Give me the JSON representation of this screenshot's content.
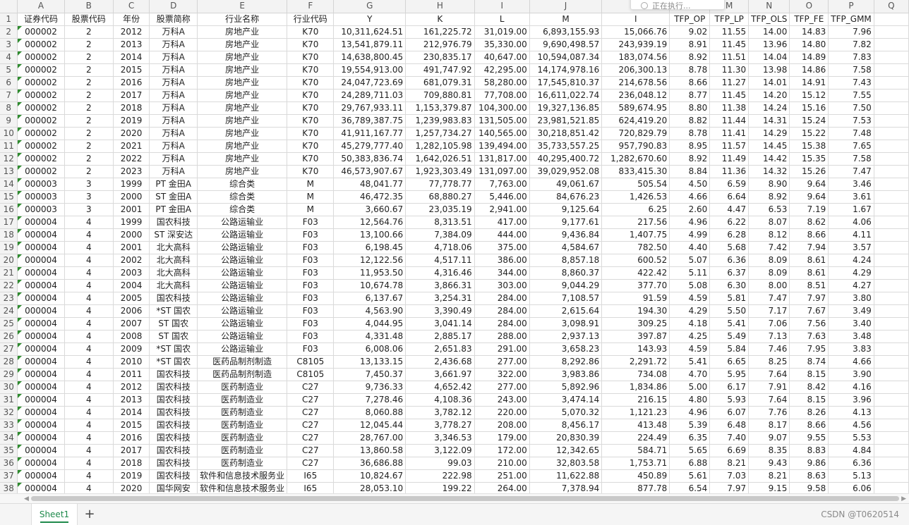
{
  "app": {
    "popup_text": "正在执行...",
    "sheet_tab": "Sheet1",
    "add_sheet_symbol": "+",
    "watermark": "CSDN @T0620514",
    "accent_color": "#1f8a4c"
  },
  "column_letters": [
    "A",
    "B",
    "C",
    "D",
    "E",
    "F",
    "G",
    "H",
    "I",
    "J",
    "K",
    "L",
    "M",
    "N",
    "O",
    "P",
    "Q"
  ],
  "headers": [
    "证券代码",
    "股票代码",
    "年份",
    "股票简称",
    "行业名称",
    "行业代码",
    "Y",
    "K",
    "L",
    "M",
    "I",
    "TFP_OP",
    "TFP_LP",
    "TFP_OLS",
    "TFP_FE",
    "TFP_GMM",
    ""
  ],
  "rows": [
    [
      "000002",
      "2",
      "2012",
      "万科A",
      "房地产业",
      "K70",
      "10,311,624.51",
      "161,225.72",
      "31,019.00",
      "6,893,155.93",
      "15,066.76",
      "9.02",
      "11.55",
      "14.00",
      "14.83",
      "7.96",
      ""
    ],
    [
      "000002",
      "2",
      "2013",
      "万科A",
      "房地产业",
      "K70",
      "13,541,879.11",
      "212,976.79",
      "35,330.00",
      "9,690,498.57",
      "243,939.19",
      "8.91",
      "11.45",
      "13.96",
      "14.80",
      "7.82",
      ""
    ],
    [
      "000002",
      "2",
      "2014",
      "万科A",
      "房地产业",
      "K70",
      "14,638,800.45",
      "230,835.17",
      "40,647.00",
      "10,594,087.34",
      "183,074.56",
      "8.92",
      "11.51",
      "14.04",
      "14.89",
      "7.83",
      ""
    ],
    [
      "000002",
      "2",
      "2015",
      "万科A",
      "房地产业",
      "K70",
      "19,554,913.00",
      "491,747.92",
      "42,295.00",
      "14,174,978.16",
      "206,300.13",
      "8.78",
      "11.30",
      "13.98",
      "14.86",
      "7.58",
      ""
    ],
    [
      "000002",
      "2",
      "2016",
      "万科A",
      "房地产业",
      "K70",
      "24,047,723.69",
      "681,079.31",
      "58,280.00",
      "17,545,810.37",
      "214,678.56",
      "8.66",
      "11.27",
      "14.01",
      "14.91",
      "7.43",
      ""
    ],
    [
      "000002",
      "2",
      "2017",
      "万科A",
      "房地产业",
      "K70",
      "24,289,711.03",
      "709,880.81",
      "77,708.00",
      "16,611,022.74",
      "236,048.12",
      "8.77",
      "11.45",
      "14.20",
      "15.12",
      "7.55",
      ""
    ],
    [
      "000002",
      "2",
      "2018",
      "万科A",
      "房地产业",
      "K70",
      "29,767,933.11",
      "1,153,379.87",
      "104,300.00",
      "19,327,136.85",
      "589,674.95",
      "8.80",
      "11.38",
      "14.24",
      "15.16",
      "7.50",
      ""
    ],
    [
      "000002",
      "2",
      "2019",
      "万科A",
      "房地产业",
      "K70",
      "36,789,387.75",
      "1,239,983.83",
      "131,505.00",
      "23,981,521.85",
      "624,419.20",
      "8.82",
      "11.44",
      "14.31",
      "15.24",
      "7.53",
      ""
    ],
    [
      "000002",
      "2",
      "2020",
      "万科A",
      "房地产业",
      "K70",
      "41,911,167.77",
      "1,257,734.27",
      "140,565.00",
      "30,218,851.42",
      "720,829.79",
      "8.78",
      "11.41",
      "14.29",
      "15.22",
      "7.48",
      ""
    ],
    [
      "000002",
      "2",
      "2021",
      "万科A",
      "房地产业",
      "K70",
      "45,279,777.40",
      "1,282,105.98",
      "139,494.00",
      "35,733,557.25",
      "957,790.83",
      "8.95",
      "11.57",
      "14.45",
      "15.38",
      "7.65",
      ""
    ],
    [
      "000002",
      "2",
      "2022",
      "万科A",
      "房地产业",
      "K70",
      "50,383,836.74",
      "1,642,026.51",
      "131,817.00",
      "40,295,400.72",
      "1,282,670.60",
      "8.92",
      "11.49",
      "14.42",
      "15.35",
      "7.58",
      ""
    ],
    [
      "000002",
      "2",
      "2023",
      "万科A",
      "房地产业",
      "K70",
      "46,573,907.67",
      "1,923,303.49",
      "131,097.00",
      "39,029,952.08",
      "833,415.30",
      "8.84",
      "11.36",
      "14.32",
      "15.26",
      "7.47",
      ""
    ],
    [
      "000003",
      "3",
      "1999",
      "PT 金田A",
      "综合类",
      "M",
      "48,041.77",
      "77,778.77",
      "7,763.00",
      "49,061.67",
      "505.54",
      "4.50",
      "6.59",
      "8.90",
      "9.64",
      "3.46",
      ""
    ],
    [
      "000003",
      "3",
      "2000",
      "ST 金田A",
      "综合类",
      "M",
      "46,472.35",
      "68,880.27",
      "5,446.00",
      "84,676.23",
      "1,426.53",
      "4.66",
      "6.64",
      "8.92",
      "9.64",
      "3.61",
      ""
    ],
    [
      "000003",
      "3",
      "2001",
      "PT 金田A",
      "综合类",
      "M",
      "3,660.67",
      "23,035.19",
      "2,941.00",
      "9,125.64",
      "6.25",
      "2.60",
      "4.47",
      "6.53",
      "7.19",
      "1.67",
      ""
    ],
    [
      "000004",
      "4",
      "1999",
      "国农科技",
      "公路运输业",
      "F03",
      "12,564.76",
      "8,313.51",
      "417.00",
      "9,177.61",
      "217.56",
      "4.96",
      "6.22",
      "8.07",
      "8.62",
      "4.06",
      ""
    ],
    [
      "000004",
      "4",
      "2000",
      "ST 深安达",
      "公路运输业",
      "F03",
      "13,100.66",
      "7,384.09",
      "444.00",
      "9,436.84",
      "1,407.75",
      "4.99",
      "6.28",
      "8.12",
      "8.66",
      "4.11",
      ""
    ],
    [
      "000004",
      "4",
      "2001",
      "北大高科",
      "公路运输业",
      "F03",
      "6,198.45",
      "4,718.06",
      "375.00",
      "4,584.67",
      "782.50",
      "4.40",
      "5.68",
      "7.42",
      "7.94",
      "3.57",
      ""
    ],
    [
      "000004",
      "4",
      "2002",
      "北大高科",
      "公路运输业",
      "F03",
      "12,122.56",
      "4,517.11",
      "386.00",
      "8,857.18",
      "600.52",
      "5.07",
      "6.36",
      "8.09",
      "8.61",
      "4.24",
      ""
    ],
    [
      "000004",
      "4",
      "2003",
      "北大高科",
      "公路运输业",
      "F03",
      "11,953.50",
      "4,316.46",
      "344.00",
      "8,860.37",
      "422.42",
      "5.11",
      "6.37",
      "8.09",
      "8.61",
      "4.29",
      ""
    ],
    [
      "000004",
      "4",
      "2004",
      "北大高科",
      "公路运输业",
      "F03",
      "10,674.78",
      "3,866.31",
      "303.00",
      "9,044.29",
      "377.70",
      "5.08",
      "6.30",
      "8.00",
      "8.51",
      "4.27",
      ""
    ],
    [
      "000004",
      "4",
      "2005",
      "国农科技",
      "公路运输业",
      "F03",
      "6,137.67",
      "3,254.31",
      "284.00",
      "7,108.57",
      "91.59",
      "4.59",
      "5.81",
      "7.47",
      "7.97",
      "3.80",
      ""
    ],
    [
      "000004",
      "4",
      "2006",
      "*ST 国农",
      "公路运输业",
      "F03",
      "4,563.90",
      "3,390.49",
      "284.00",
      "2,615.64",
      "194.30",
      "4.29",
      "5.50",
      "7.17",
      "7.67",
      "3.49",
      ""
    ],
    [
      "000004",
      "4",
      "2007",
      "ST 国农",
      "公路运输业",
      "F03",
      "4,044.95",
      "3,041.14",
      "284.00",
      "3,098.91",
      "309.25",
      "4.18",
      "5.41",
      "7.06",
      "7.56",
      "3.40",
      ""
    ],
    [
      "000004",
      "4",
      "2008",
      "ST 国农",
      "公路运输业",
      "F03",
      "4,331.48",
      "2,885.17",
      "288.00",
      "2,937.13",
      "397.87",
      "4.25",
      "5.49",
      "7.13",
      "7.63",
      "3.48",
      ""
    ],
    [
      "000004",
      "4",
      "2009",
      "*ST 国农",
      "公路运输业",
      "F03",
      "6,008.06",
      "2,651.83",
      "291.00",
      "3,658.23",
      "143.93",
      "4.59",
      "5.84",
      "7.46",
      "7.95",
      "3.83",
      ""
    ],
    [
      "000004",
      "4",
      "2010",
      "*ST 国农",
      "医药品制剂制造",
      "C8105",
      "13,133.15",
      "2,436.68",
      "277.00",
      "8,292.86",
      "2,291.72",
      "5.41",
      "6.65",
      "8.25",
      "8.74",
      "4.66",
      ""
    ],
    [
      "000004",
      "4",
      "2011",
      "国农科技",
      "医药品制剂制造",
      "C8105",
      "7,450.37",
      "3,661.97",
      "322.00",
      "3,983.86",
      "734.08",
      "4.70",
      "5.95",
      "7.64",
      "8.15",
      "3.90",
      ""
    ],
    [
      "000004",
      "4",
      "2012",
      "国农科技",
      "医药制造业",
      "C27",
      "9,736.33",
      "4,652.42",
      "277.00",
      "5,892.96",
      "1,834.86",
      "5.00",
      "6.17",
      "7.91",
      "8.42",
      "4.16",
      ""
    ],
    [
      "000004",
      "4",
      "2013",
      "国农科技",
      "医药制造业",
      "C27",
      "7,278.46",
      "4,108.36",
      "243.00",
      "3,474.14",
      "216.15",
      "4.80",
      "5.93",
      "7.64",
      "8.15",
      "3.96",
      ""
    ],
    [
      "000004",
      "4",
      "2014",
      "国农科技",
      "医药制造业",
      "C27",
      "8,060.88",
      "3,782.12",
      "220.00",
      "5,070.32",
      "1,121.23",
      "4.96",
      "6.07",
      "7.76",
      "8.26",
      "4.13",
      ""
    ],
    [
      "000004",
      "4",
      "2015",
      "国农科技",
      "医药制造业",
      "C27",
      "12,045.44",
      "3,778.27",
      "208.00",
      "8,456.17",
      "413.48",
      "5.39",
      "6.48",
      "8.17",
      "8.66",
      "4.56",
      ""
    ],
    [
      "000004",
      "4",
      "2016",
      "国农科技",
      "医药制造业",
      "C27",
      "28,767.00",
      "3,346.53",
      "179.00",
      "20,830.39",
      "224.49",
      "6.35",
      "7.40",
      "9.07",
      "9.55",
      "5.53",
      ""
    ],
    [
      "000004",
      "4",
      "2017",
      "国农科技",
      "医药制造业",
      "C27",
      "13,860.58",
      "3,122.09",
      "172.00",
      "12,342.65",
      "584.71",
      "5.65",
      "6.69",
      "8.35",
      "8.83",
      "4.84",
      ""
    ],
    [
      "000004",
      "4",
      "2018",
      "国农科技",
      "医药制造业",
      "C27",
      "36,686.88",
      "99.03",
      "210.00",
      "32,803.58",
      "1,753.71",
      "6.88",
      "8.21",
      "9.43",
      "9.86",
      "6.36",
      ""
    ],
    [
      "000004",
      "4",
      "2019",
      "国农科技",
      "软件和信息技术服务业",
      "I65",
      "10,824.67",
      "222.98",
      "251.00",
      "11,622.88",
      "450.89",
      "5.61",
      "7.03",
      "8.21",
      "8.63",
      "5.13",
      ""
    ],
    [
      "000004",
      "4",
      "2020",
      "国华网安",
      "软件和信息技术服务业",
      "I65",
      "28,053.10",
      "199.22",
      "264.00",
      "7,378.94",
      "877.78",
      "6.54",
      "7.97",
      "9.15",
      "9.58",
      "6.06",
      ""
    ]
  ]
}
